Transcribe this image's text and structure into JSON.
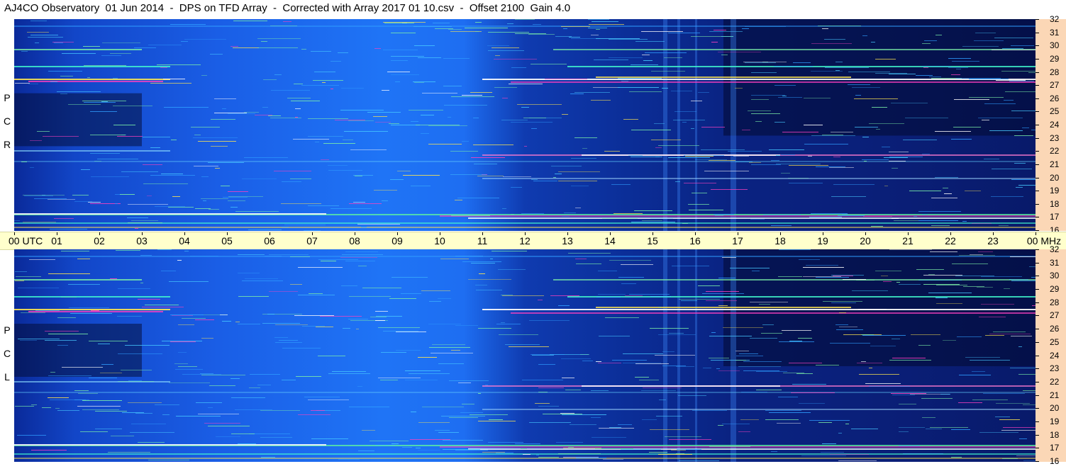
{
  "header": {
    "title": "AJ4CO Observatory  01 Jun 2014  -  DPS on TFD Array  -  Corrected with Array 2017 01 10.csv  -  Offset 2100  Gain 4.0"
  },
  "panels": {
    "top": {
      "polarization": [
        "R",
        "C",
        "P"
      ]
    },
    "bottom": {
      "polarization": [
        "L",
        "C",
        "P"
      ]
    }
  },
  "frequency_axis": {
    "labels": [
      "32",
      "31",
      "30",
      "29",
      "28",
      "27",
      "26",
      "25",
      "24",
      "23",
      "22",
      "21",
      "20",
      "19",
      "18",
      "17",
      "16"
    ]
  },
  "time_axis": {
    "labels": [
      "00",
      "01",
      "02",
      "03",
      "04",
      "05",
      "06",
      "07",
      "08",
      "09",
      "10",
      "11",
      "12",
      "13",
      "14",
      "15",
      "16",
      "17",
      "18",
      "19",
      "20",
      "21",
      "22",
      "23",
      "00"
    ],
    "utc_label": "UTC",
    "mhz_label": "MHz"
  },
  "colors": {
    "background_dark": "#071a6e",
    "quiet_blue": "#1c6cf0",
    "time_bar": "#ffffcc",
    "freq_bar": "#fbd7b6"
  }
}
